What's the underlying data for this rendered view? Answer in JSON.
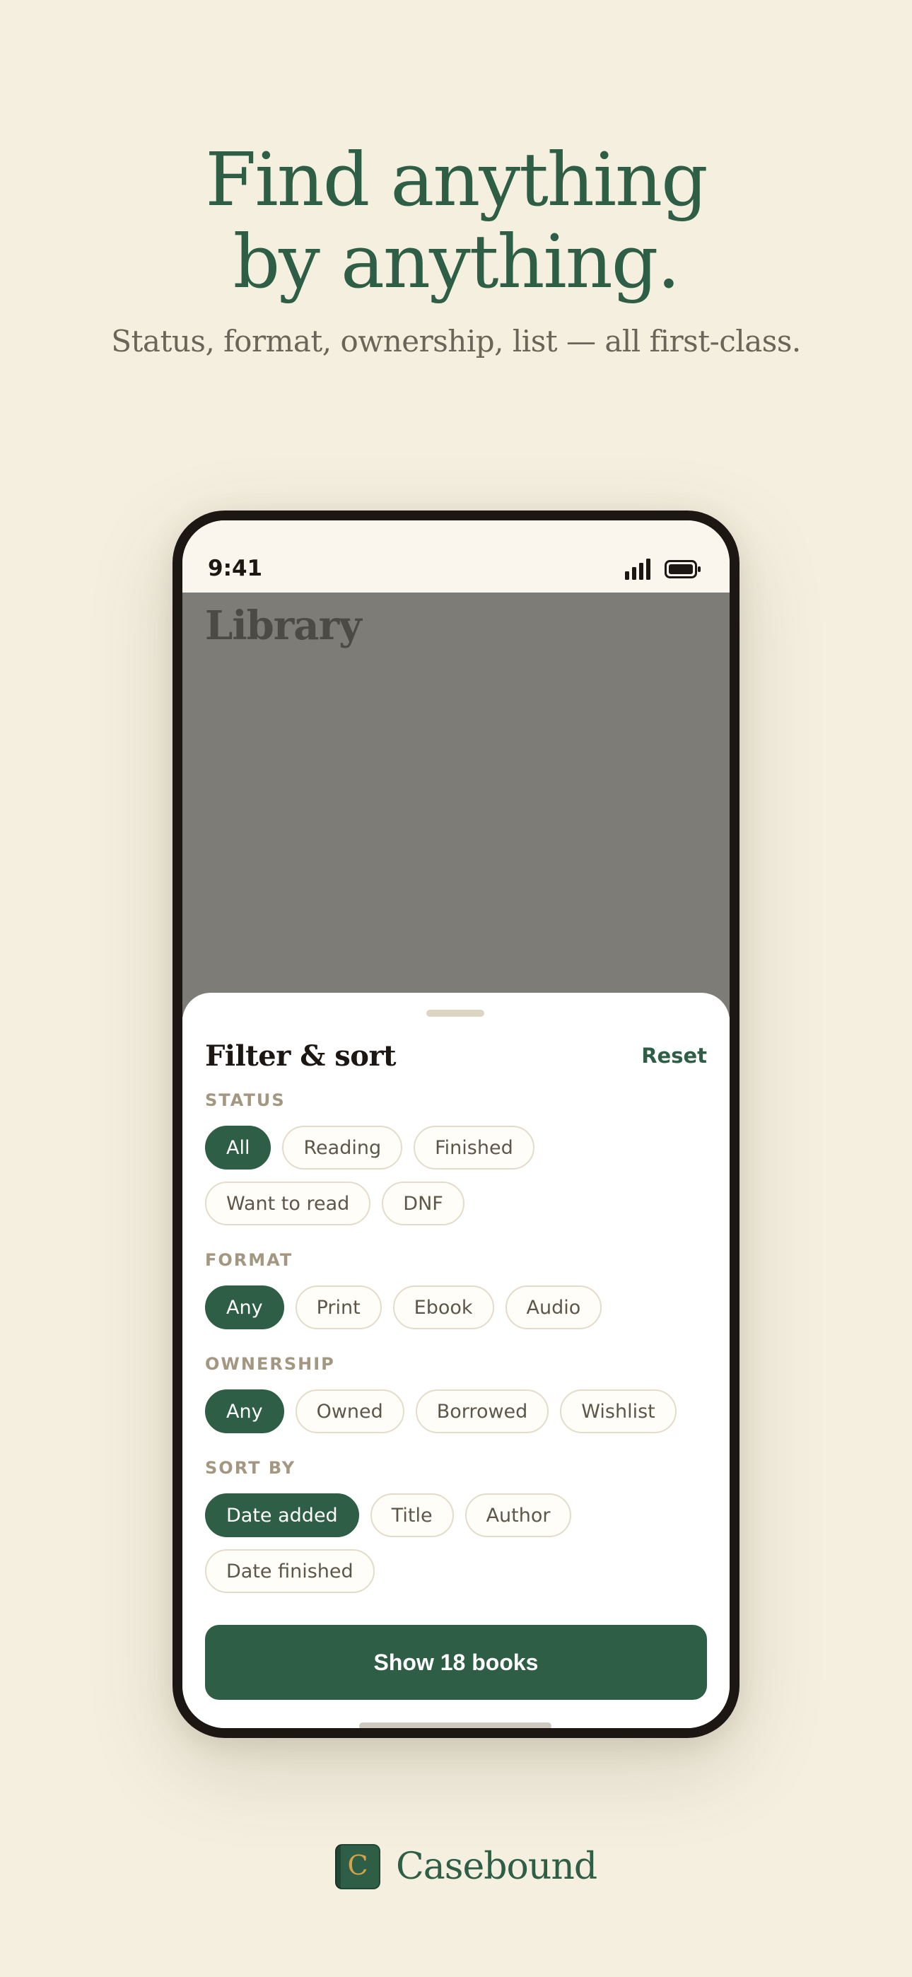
{
  "hero": {
    "headline_line1": "Find anything",
    "headline_line2": "by anything.",
    "subhead": "Status, format, ownership, list — all first-class."
  },
  "phone": {
    "status_bar": {
      "time": "9:41",
      "icons": [
        "cellular-signal-icon",
        "battery-icon"
      ]
    },
    "library_title": "Library",
    "sheet": {
      "title": "Filter & sort",
      "reset_label": "Reset",
      "sections": {
        "status": {
          "label": "STATUS",
          "options": [
            "All",
            "Reading",
            "Finished",
            "Want to read",
            "DNF"
          ],
          "selected": "All"
        },
        "format": {
          "label": "FORMAT",
          "options": [
            "Any",
            "Print",
            "Ebook",
            "Audio"
          ],
          "selected": "Any"
        },
        "ownership": {
          "label": "OWNERSHIP",
          "options": [
            "Any",
            "Owned",
            "Borrowed",
            "Wishlist"
          ],
          "selected": "Any"
        },
        "sort_by": {
          "label": "SORT BY",
          "options": [
            "Date added",
            "Title",
            "Author",
            "Date finished"
          ],
          "selected": "Date added"
        }
      },
      "cta_label": "Show 18 books"
    }
  },
  "brand": {
    "letter": "C",
    "name": "Casebound"
  },
  "colors": {
    "background": "#f5efe0",
    "accent": "#2e5e46",
    "chip_border": "#e3dccb",
    "section_label": "#a39782",
    "dimmed_overlay": "#7e7c77",
    "brand_letter": "#d6a24a"
  }
}
